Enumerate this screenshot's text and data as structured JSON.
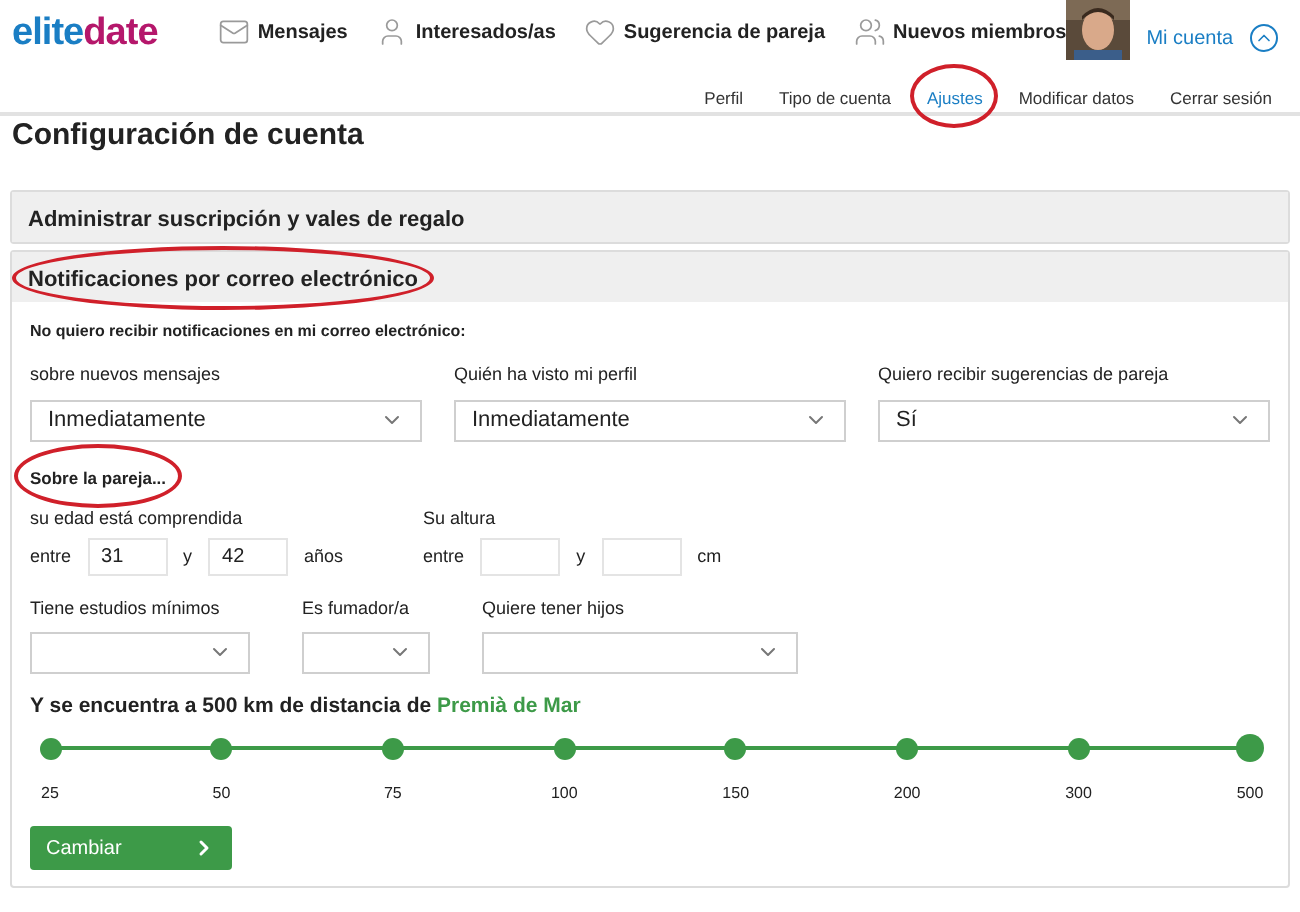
{
  "logo": {
    "part_1": "elite",
    "part_2": "date"
  },
  "main_nav": [
    {
      "kind": "mail",
      "label": "Mensajes"
    },
    {
      "kind": "person",
      "label": "Interesados/as"
    },
    {
      "kind": "heart",
      "label": "Sugerencia de pareja"
    },
    {
      "kind": "people",
      "label": "Nuevos miembros"
    }
  ],
  "account": {
    "label": "Mi cuenta",
    "expanded": true
  },
  "sub_nav": [
    {
      "label": "Perfil",
      "selected": false,
      "circled": false
    },
    {
      "label": "Tipo de cuenta",
      "selected": false,
      "circled": false
    },
    {
      "label": "Ajustes",
      "selected": true,
      "circled": true
    },
    {
      "label": "Modificar datos",
      "selected": false,
      "circled": false
    },
    {
      "label": "Cerrar sesión",
      "selected": false,
      "circled": false
    }
  ],
  "page_title": "Configuración de cuenta",
  "sections": [
    {
      "title": "Administrar suscripción y vales de regalo",
      "expanded": false,
      "circled": false
    },
    {
      "title": "Notificaciones por correo electrónico",
      "expanded": true,
      "circled": true
    }
  ],
  "notifications": {
    "intro": "No quiero recibir notificaciones en mi correo electrónico:",
    "selects": [
      {
        "label": "sobre nuevos mensajes",
        "value": "Inmediatamente"
      },
      {
        "label": "Quién ha visto mi perfil",
        "value": "Inmediatamente"
      },
      {
        "label": "Quiero recibir sugerencias de pareja",
        "value": "Sí"
      }
    ]
  },
  "partner": {
    "heading": "Sobre la pareja...",
    "heading_circled": true,
    "age": {
      "label": "su edad está comprendida",
      "from_text": "entre",
      "from": "31",
      "and_text": "y",
      "to": "42",
      "unit": "años"
    },
    "height": {
      "label": "Su altura",
      "from_text": "entre",
      "and_text": "y",
      "unit": "cm"
    },
    "selects": [
      {
        "label": "Tiene estudios mínimos"
      },
      {
        "label": "Es fumador/a"
      },
      {
        "label": "Quiere tener hijos"
      }
    ]
  },
  "distance": {
    "text_before": "Y se encuentra a 500 km de distancia de",
    "place": "Premià de Mar",
    "level": 1,
    "stops": [
      {
        "label": "25",
        "selected": false
      },
      {
        "label": "50",
        "selected": false
      },
      {
        "label": "75",
        "selected": false
      },
      {
        "label": "100",
        "selected": false
      },
      {
        "label": "150",
        "selected": false
      },
      {
        "label": "200",
        "selected": false
      },
      {
        "label": "300",
        "selected": false
      },
      {
        "label": "500",
        "selected": true
      }
    ]
  },
  "submit": {
    "label": "Cambiar"
  }
}
